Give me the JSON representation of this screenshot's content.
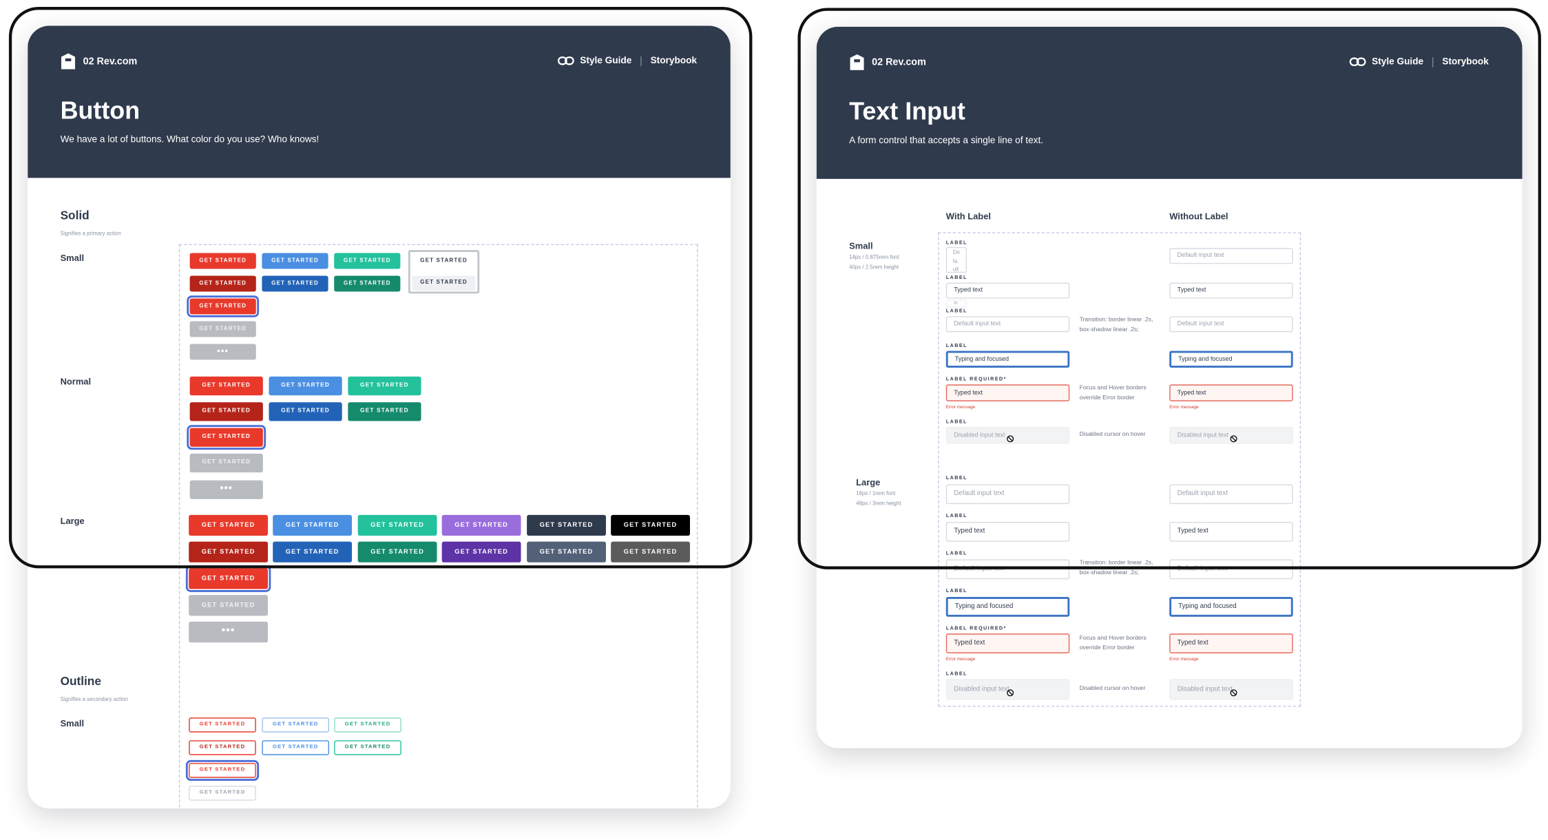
{
  "brand": "02 Rev.com",
  "nav": {
    "style_guide": "Style Guide",
    "storybook": "Storybook"
  },
  "colors": {
    "header": "#303a4d",
    "red": "#e8392b",
    "blue": "#4a8fe2",
    "teal": "#23c19c",
    "purple": "#9a6ddc",
    "navy": "#303a4d",
    "black": "#000000",
    "focus": "#3b73c6",
    "error": "#d23a2c"
  },
  "btn_label": "GET STARTED",
  "button_page": {
    "title": "Button",
    "subtitle": "We have a lot of buttons. What color do you use? Who knows!",
    "solid": {
      "title": "Solid",
      "subtitle": "Signifies a primary action"
    },
    "outline": {
      "title": "Outline",
      "subtitle": "Signifies a secondary action"
    },
    "sizes": {
      "small": "Small",
      "normal": "Normal",
      "large": "Large"
    },
    "loading_label": "•••"
  },
  "input_page": {
    "title": "Text Input",
    "subtitle": "A form control that accepts a single line of text.",
    "columns": {
      "with_label": "With Label",
      "without_label": "Without Label"
    },
    "small": {
      "title": "Small",
      "spec1": "14px / 0.875rem font",
      "spec2": "40px / 2.5rem height"
    },
    "large": {
      "title": "Large",
      "spec1": "16px / 1rem font",
      "spec2": "48px / 3rem height"
    },
    "label": "LABEL",
    "label_required": "LABEL REQUIRED*",
    "default_text": "Default input text",
    "typed_text": "Typed text",
    "focused_text": "Typing and focused",
    "disabled_text": "Disabled input text",
    "error_message": "Error message",
    "default_fragments": [
      "De",
      "fa",
      "ult",
      "in"
    ],
    "note_transition_1": "Transition: border linear .2s,",
    "note_transition_2": "box-shadow linear .2s;",
    "note_focus_1": "Focus and Hover borders",
    "note_focus_2": "override Error border",
    "note_disabled": "Disabled cursor on hover"
  }
}
